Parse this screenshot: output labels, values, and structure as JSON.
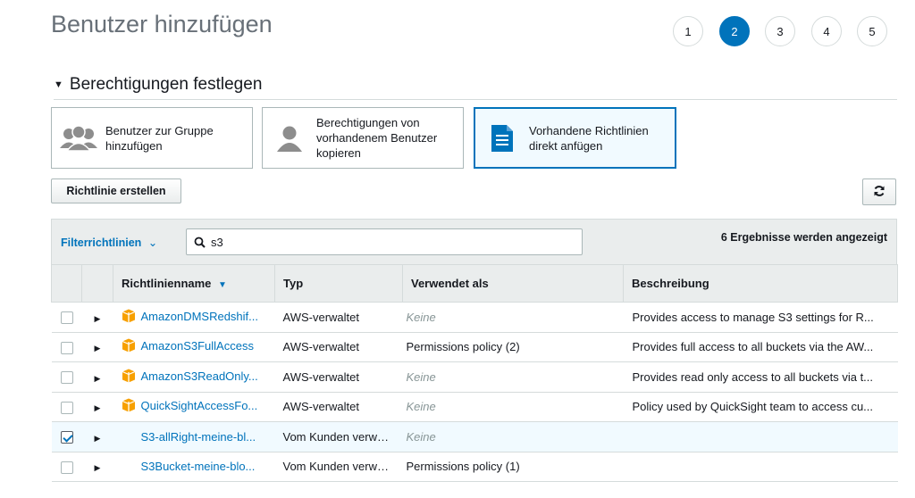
{
  "page": {
    "title": "Benutzer hinzufügen",
    "steps": [
      "1",
      "2",
      "3",
      "4",
      "5"
    ],
    "active_step": "2"
  },
  "section": {
    "title": "Berechtigungen festlegen"
  },
  "options": [
    {
      "label": "Benutzer zur Gruppe hinzufügen",
      "icon": "group-icon"
    },
    {
      "label": "Berechtigungen von vorhandenem Benutzer kopieren",
      "icon": "user-icon"
    },
    {
      "label": "Vorhandene Richtlinien direkt anfügen",
      "icon": "document-icon"
    }
  ],
  "toolbar": {
    "create_policy_label": "Richtlinie erstellen",
    "refresh_icon": "refresh-icon"
  },
  "filter": {
    "label": "Filterrichtlinien",
    "search_value": "s3",
    "result_count": "6 Ergebnisse werden angezeigt"
  },
  "table": {
    "columns": [
      "Richtlinienname",
      "Typ",
      "Verwendet als",
      "Beschreibung"
    ],
    "rows": [
      {
        "name": "AmazonDMSRedshif...",
        "type": "AWS-verwaltet",
        "used_as": "Keine",
        "description": "Provides access to manage S3 settings for R...",
        "checked": false,
        "aws_icon": true
      },
      {
        "name": "AmazonS3FullAccess",
        "type": "AWS-verwaltet",
        "used_as": "Permissions policy (2)",
        "description": "Provides full access to all buckets via the AW...",
        "checked": false,
        "aws_icon": true
      },
      {
        "name": "AmazonS3ReadOnly...",
        "type": "AWS-verwaltet",
        "used_as": "Keine",
        "description": "Provides read only access to all buckets via t...",
        "checked": false,
        "aws_icon": true
      },
      {
        "name": "QuickSightAccessFo...",
        "type": "AWS-verwaltet",
        "used_as": "Keine",
        "description": "Policy used by QuickSight team to access cu...",
        "checked": false,
        "aws_icon": true
      },
      {
        "name": "S3-allRight-meine-bl...",
        "type": "Vom Kunden verwaltet",
        "used_as": "Keine",
        "description": "",
        "checked": true,
        "aws_icon": false
      },
      {
        "name": "S3Bucket-meine-blo...",
        "type": "Vom Kunden verwaltet",
        "used_as": "Permissions policy (1)",
        "description": "",
        "checked": false,
        "aws_icon": false
      }
    ]
  },
  "colors": {
    "accent": "#0073bb",
    "aws_orange": "#f7a000",
    "header_bg": "#eaeded",
    "selected_bg": "#f1faff"
  }
}
